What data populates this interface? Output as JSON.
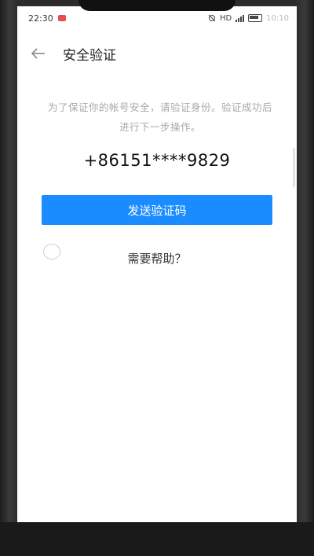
{
  "status_bar": {
    "time": "22:30",
    "network": "HD",
    "battery_time": "10:10"
  },
  "header": {
    "back_icon": "arrow-left-icon",
    "title": "安全验证"
  },
  "main": {
    "description": "为了保证你的帐号安全，请验证身份。验证成功后进行下一步操作。",
    "phone_number": "+86151****9829",
    "send_button_label": "发送验证码",
    "help_label": "需要帮助？"
  },
  "colors": {
    "accent": "#1a8cff",
    "description_text": "#a8a8a8"
  }
}
